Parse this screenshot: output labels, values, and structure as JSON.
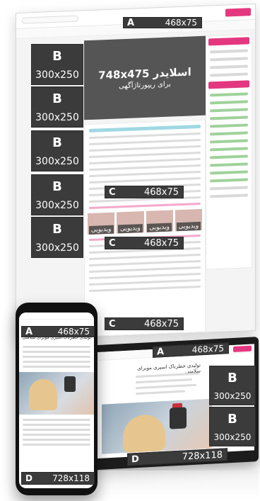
{
  "slider": {
    "size": "748x475",
    "caption": "اسلایدر",
    "subcaption": "برای ریپورتاژآگهی"
  },
  "ads": {
    "A": {
      "letter": "A",
      "size": "468x75"
    },
    "B": {
      "letter": "B",
      "size": "300x250"
    },
    "C": {
      "letter": "C",
      "size": "468x75"
    },
    "D": {
      "letter": "D",
      "size": "728x118"
    }
  },
  "video_label": "ویدیویی",
  "article_title": "تولیدی خطرناک اسپری موبرای سلامتی",
  "colors": {
    "accent": "#e3387f",
    "adbox": "#3b3b3b",
    "green": "#9fd29a",
    "cyan": "#9fd8e3"
  }
}
